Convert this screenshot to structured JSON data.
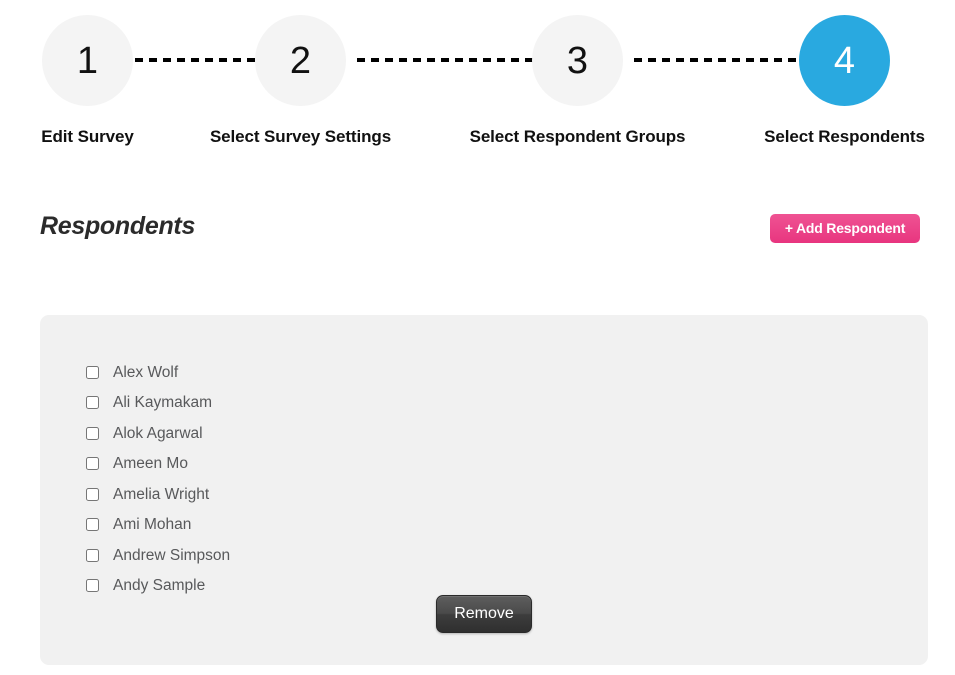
{
  "stepper": {
    "steps": [
      {
        "number": "1",
        "label": "Edit Survey",
        "active": false
      },
      {
        "number": "2",
        "label": "Select Survey Settings",
        "active": false
      },
      {
        "number": "3",
        "label": "Select Respondent Groups",
        "active": false
      },
      {
        "number": "4",
        "label": "Select Respondents",
        "active": true
      }
    ],
    "active_color": "#29a9e0",
    "inactive_color": "#f4f4f4"
  },
  "section": {
    "title": "Respondents",
    "add_button_label": "+ Add Respondent",
    "add_button_color": "#e8357f"
  },
  "panel": {
    "background_color": "#f1f1f1",
    "respondents": [
      {
        "name": "Alex Wolf",
        "checked": false
      },
      {
        "name": "Ali Kaymakam",
        "checked": false
      },
      {
        "name": "Alok Agarwal",
        "checked": false
      },
      {
        "name": "Ameen Mo",
        "checked": false
      },
      {
        "name": "Amelia Wright",
        "checked": false
      },
      {
        "name": "Ami Mohan",
        "checked": false
      },
      {
        "name": "Andrew Simpson",
        "checked": false
      },
      {
        "name": "Andy Sample",
        "checked": false
      }
    ],
    "remove_button_label": "Remove"
  }
}
